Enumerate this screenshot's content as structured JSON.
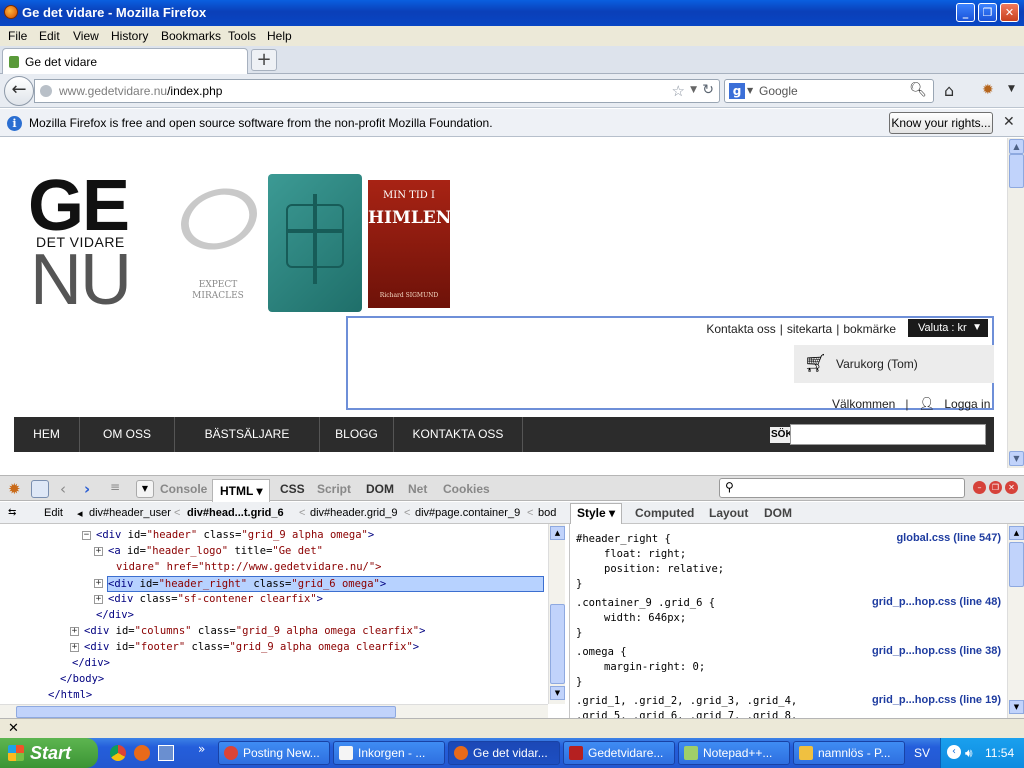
{
  "window": {
    "title": "Ge det vidare - Mozilla Firefox"
  },
  "menu": [
    "File",
    "Edit",
    "View",
    "History",
    "Bookmarks",
    "Tools",
    "Help"
  ],
  "tab": {
    "label": "Ge det vidare",
    "new_tab": "+"
  },
  "nav": {
    "url_domain": "www.gedetvidare.nu",
    "url_path": "/index.php",
    "search_engine": "Google"
  },
  "notification": {
    "message": "Mozilla Firefox is free and open source software from the non-profit Mozilla Foundation.",
    "button": "Know your rights..."
  },
  "site": {
    "logo_top": "GE",
    "logo_middle": "DET VIDARE",
    "logo_bottom": "NU",
    "bracelet_caption_1": "EXPECT",
    "bracelet_caption_2": "MIRACLES",
    "book_title_1": "MIN TID I",
    "book_title_2": "HIMLEN",
    "book_author": "Richard SIGMUND",
    "top_links": [
      "Kontakta oss",
      "sitekarta",
      "bokmärke"
    ],
    "currency": "Valuta : kr",
    "cart": "Varukorg (Tom)",
    "welcome": "Välkommen",
    "login": "Logga in",
    "menu": [
      "HEM",
      "OM OSS",
      "BÄSTSÄLJARE",
      "BLOGG",
      "KONTAKTA OSS"
    ],
    "search_label": "SÖK"
  },
  "firebug": {
    "tabs": [
      "Console",
      "HTML",
      "CSS",
      "Script",
      "DOM",
      "Net",
      "Cookies"
    ],
    "active_tab": "HTML",
    "edit": "Edit",
    "breadcrumbs": [
      "div#header_user",
      "div#head...t.grid_6",
      "div#header.grid_9",
      "div#page.container_9",
      "bod"
    ],
    "side_tabs": [
      "Style",
      "Computed",
      "Layout",
      "DOM"
    ],
    "html_lines": [
      {
        "indent": 0,
        "toggle": "−",
        "tag": "div",
        "attrs": [
          [
            "id",
            "header"
          ],
          [
            "class",
            "grid_9 alpha omega"
          ]
        ],
        "suffix": ">"
      },
      {
        "indent": 1,
        "toggle": "+",
        "tag": "a",
        "attrs": [
          [
            "id",
            "header_logo"
          ],
          [
            "title",
            "Ge det"
          ]
        ],
        "suffix": ""
      },
      {
        "indent": 1,
        "toggle": "",
        "continuation": "vidare\" href=\"http://www.gedetvidare.nu/\">"
      },
      {
        "indent": 1,
        "toggle": "+",
        "tag": "div",
        "attrs": [
          [
            "id",
            "header_right"
          ],
          [
            "class",
            "grid_6 omega"
          ]
        ],
        "suffix": ">",
        "selected": true
      },
      {
        "indent": 1,
        "toggle": "+",
        "tag": "div",
        "attrs": [
          [
            "class",
            "sf-contener clearfix"
          ]
        ],
        "suffix": ">"
      },
      {
        "indent": 0,
        "toggle": "",
        "close": "</div>"
      },
      {
        "indent": -1,
        "toggle": "+",
        "tag": "div",
        "attrs": [
          [
            "id",
            "columns"
          ],
          [
            "class",
            "grid_9 alpha omega clearfix"
          ]
        ],
        "suffix": ">"
      },
      {
        "indent": -1,
        "toggle": "+",
        "tag": "div",
        "attrs": [
          [
            "id",
            "footer"
          ],
          [
            "class",
            "grid_9 alpha omega clearfix"
          ]
        ],
        "suffix": ">"
      },
      {
        "indent": -2,
        "toggle": "",
        "close": "</div>"
      },
      {
        "indent": -3,
        "toggle": "",
        "close": "</body>"
      },
      {
        "indent": -4,
        "toggle": "",
        "close": "</html>"
      }
    ],
    "style_rules": [
      {
        "selector": "#header_right {",
        "source": "global.css (line 547)",
        "props": [
          "float: right;",
          "position: relative;"
        ]
      },
      {
        "selector": ".container_9 .grid_6 {",
        "source": "grid_p...hop.css (line 48)",
        "props": [
          "width: 646px;"
        ]
      },
      {
        "selector": ".omega {",
        "source": "grid_p...hop.css (line 38)",
        "props": [
          "margin-right: 0;"
        ]
      },
      {
        "selector": ".grid_1, .grid_2, .grid_3, .grid_4,",
        "source": "grid_p...hop.css (line 19)",
        "props": [
          ".grid_5, .grid_6, .grid_7, .grid_8,"
        ]
      }
    ]
  },
  "taskbar": {
    "start": "Start",
    "tasks": [
      "Posting New...",
      "Inkorgen - ...",
      "Ge det vidar...",
      "Gedetvidare...",
      "Notepad++...",
      "namnlös - P..."
    ],
    "active_index": 2,
    "lang": "SV",
    "clock": "11:54"
  },
  "colors": {
    "titlebar": "#0a4fd0",
    "site_menu": "#2c2c2c",
    "firebug_source_link": "#1e3ca0",
    "selection": "#b7d2ff"
  }
}
